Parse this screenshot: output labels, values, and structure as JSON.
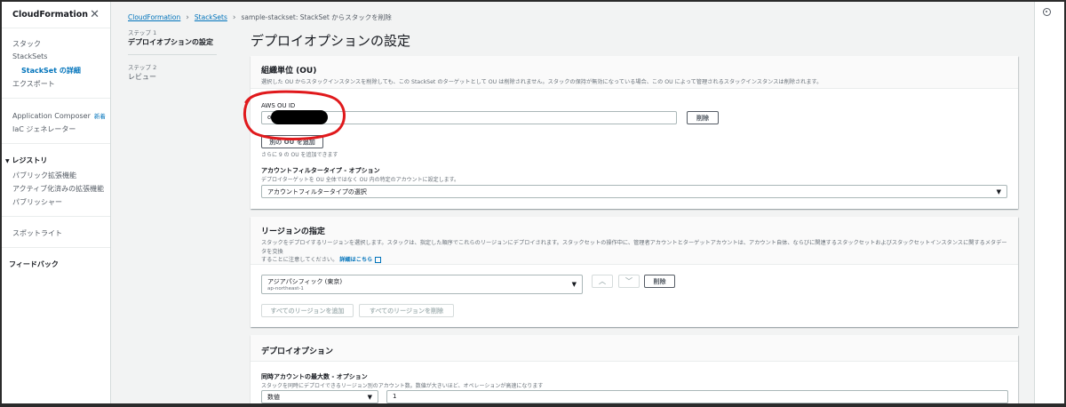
{
  "sidebar": {
    "title": "CloudFormation",
    "items": {
      "stack": "スタック",
      "stacksets": "StackSets",
      "stackset_detail": "StackSet の詳細",
      "exports": "エクスポート",
      "app_composer": "Application Composer",
      "app_composer_badge": "新着",
      "iac_generator": "IaC ジェネレーター",
      "registry": "レジストリ",
      "public_ext": "パブリック拡張機能",
      "active_ext": "アクティブ化済みの拡張機能",
      "publisher": "パブリッシャー",
      "spotlight": "スポットライト",
      "feedback": "フィードバック"
    }
  },
  "breadcrumb": {
    "root": "CloudFormation",
    "stacksets": "StackSets",
    "current": "sample-stackset: StackSet からスタックを削除"
  },
  "steps": [
    {
      "label": "ステップ 1",
      "name": "デプロイオプションの設定"
    },
    {
      "label": "ステップ 2",
      "name": "レビュー"
    }
  ],
  "page_title": "デプロイオプションの設定",
  "ou_panel": {
    "title": "組織単位 (OU)",
    "desc": "選択した OU からスタックインスタンスを削除しても、この StackSet のターゲットとして OU は削除されません。スタックの保持が無効になっている場合、この OU によって管理されるスタックインスタンスは削除されます。",
    "field_label": "AWS OU ID",
    "ou_value_prefix": "o",
    "remove_button": "削除",
    "add_button": "別の OU を追加",
    "add_hint": "さらに 9 の OU を追加できます",
    "filter_label": "アカウントフィルタータイプ - オプション",
    "filter_desc": "デプロイターゲットを OU 全体ではなく OU 内の特定のアカウントに設定します。",
    "filter_select": "アカウントフィルタータイプの選択"
  },
  "region_panel": {
    "title": "リージョンの指定",
    "desc_line1": "スタックをデプロイするリージョンを選択します。スタックは、指定した順序でこれらのリージョンにデプロイされます。スタックセットの操作中に、管理者アカウントとターゲットアカウントは、アカウント自体、ならびに関連するスタックセットおよびスタックセットインスタンスに関するメタデータを交換",
    "desc_line2": "することに注意してください。",
    "link": "詳細はこちら",
    "region_name": "アジアパシフィック (東京)",
    "region_code": "ap-northeast-1",
    "remove_button": "削除",
    "add_all": "すべてのリージョンを追加",
    "remove_all": "すべてのリージョンを削除"
  },
  "deploy_panel": {
    "title": "デプロイオプション",
    "concurrency_label": "同時アカウントの最大数 - オプション",
    "concurrency_desc": "スタックを同時にデプロイできるリージョン別のアカウント数。数値が大きいほど、オペレーションが高速になります",
    "concurrency_type": "数値",
    "concurrency_value": "1"
  },
  "colors": {
    "link": "#0073bb",
    "annotation": "#e0191c"
  }
}
